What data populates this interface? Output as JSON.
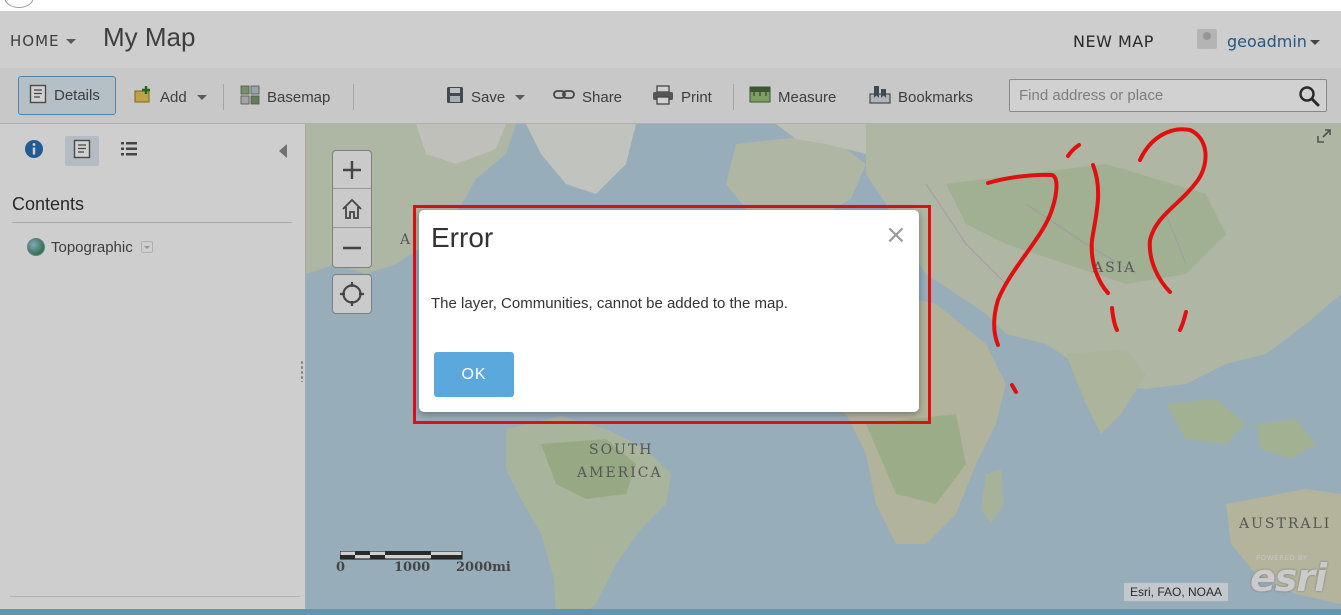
{
  "header": {
    "home_label": "HOME",
    "map_title": "My Map",
    "new_map_label": "NEW MAP",
    "username": "geoadmin"
  },
  "toolbar": {
    "details_label": "Details",
    "add_label": "Add",
    "basemap_label": "Basemap",
    "save_label": "Save",
    "share_label": "Share",
    "print_label": "Print",
    "measure_label": "Measure",
    "bookmarks_label": "Bookmarks",
    "search_placeholder": "Find address or place"
  },
  "panel": {
    "tabs": [
      "info-icon",
      "details-icon",
      "legend-list-icon"
    ],
    "contents_heading": "Contents",
    "layers": [
      {
        "label": "Topographic",
        "icon": "globe-icon"
      }
    ]
  },
  "map": {
    "labels": {
      "south_america_1": "SOUTH",
      "south_america_2": "AMERICA",
      "asia": "ASIA",
      "australia": "AUSTRALI",
      "partial_a": "A"
    },
    "scale": {
      "tick_0": "0",
      "tick_1": "1000",
      "tick_2": "2000mi"
    },
    "attribution": "Esri, FAO, NOAA",
    "logo": {
      "powered_by": "POWERED BY",
      "word": "esri"
    }
  },
  "dialog": {
    "title": "Error",
    "close_symbol": "×",
    "message": "The layer, Communities, cannot be added to the map.",
    "ok_label": "OK"
  },
  "annotation_color": "#e01010",
  "accent_color": "#5ba8dc"
}
